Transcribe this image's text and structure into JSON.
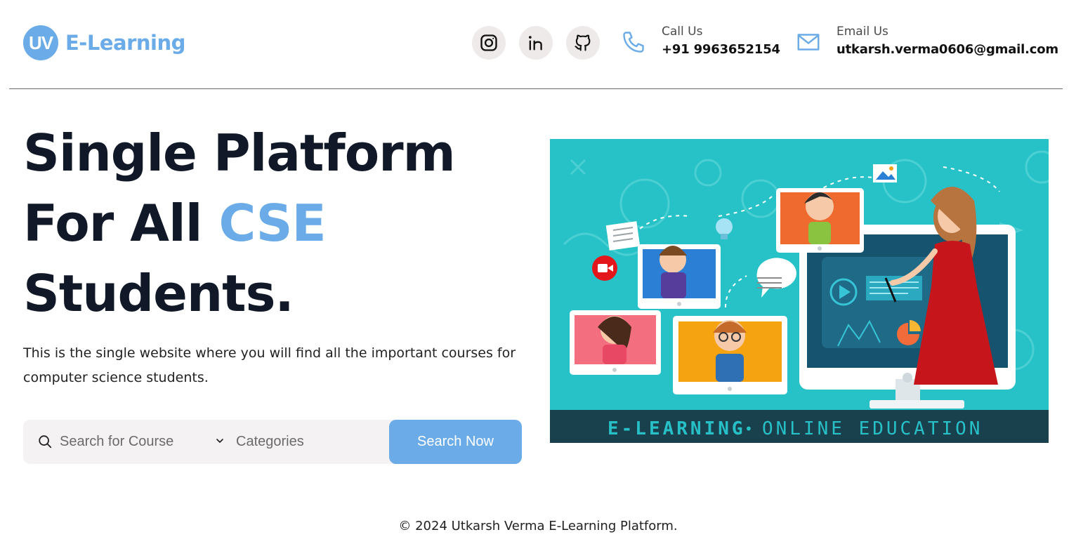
{
  "brand": {
    "logo_mark": "UV",
    "name": "E-Learning",
    "color": "#6aabe8"
  },
  "social": [
    {
      "name": "instagram",
      "icon": "instagram-icon"
    },
    {
      "name": "linkedin",
      "icon": "linkedin-icon"
    },
    {
      "name": "github",
      "icon": "github-icon"
    }
  ],
  "contact": {
    "phone": {
      "label": "Call Us",
      "value": "+91 9963652154",
      "icon": "phone-icon"
    },
    "email": {
      "label": "Email Us",
      "value": "utkarsh.verma0606@gmail.com",
      "icon": "mail-icon"
    }
  },
  "hero": {
    "title_line1": "Single Platform",
    "title_line2_prefix": "For All ",
    "title_line2_accent": "CSE",
    "title_line3": "Students.",
    "description": "This is the single website where you will find all the important courses for computer science students."
  },
  "search": {
    "placeholder": "Search for Course",
    "categories_label": "Categories",
    "button_label": "Search Now"
  },
  "illustration": {
    "caption_left": "E-LEARNING",
    "caption_separator": "•",
    "caption_right": "ONLINE EDUCATION"
  },
  "footer": {
    "text": "© 2024 Utkarsh Verma E-Learning Platform."
  }
}
